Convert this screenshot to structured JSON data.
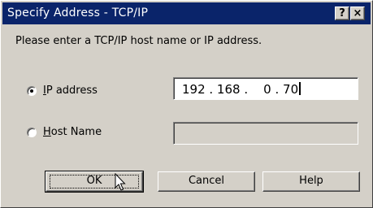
{
  "window": {
    "title": "Specify Address - TCP/IP",
    "help_button": "?",
    "close_button": "×"
  },
  "prompt": "Please enter a TCP/IP host name or IP address.",
  "options": {
    "ip": {
      "mnemonic": "I",
      "rest": "P address",
      "selected": true
    },
    "host": {
      "mnemonic": "H",
      "rest": "ost Name",
      "selected": false
    }
  },
  "ip_field": {
    "value": "192 . 168 .    0 . 70"
  },
  "host_field": {
    "value": ""
  },
  "buttons": {
    "ok": "OK",
    "cancel": "Cancel",
    "help": "Help"
  },
  "icons": {
    "cursor": "mouse-pointer-icon",
    "radio_selected": "radio-selected-icon",
    "radio_unselected": "radio-unselected-icon"
  }
}
